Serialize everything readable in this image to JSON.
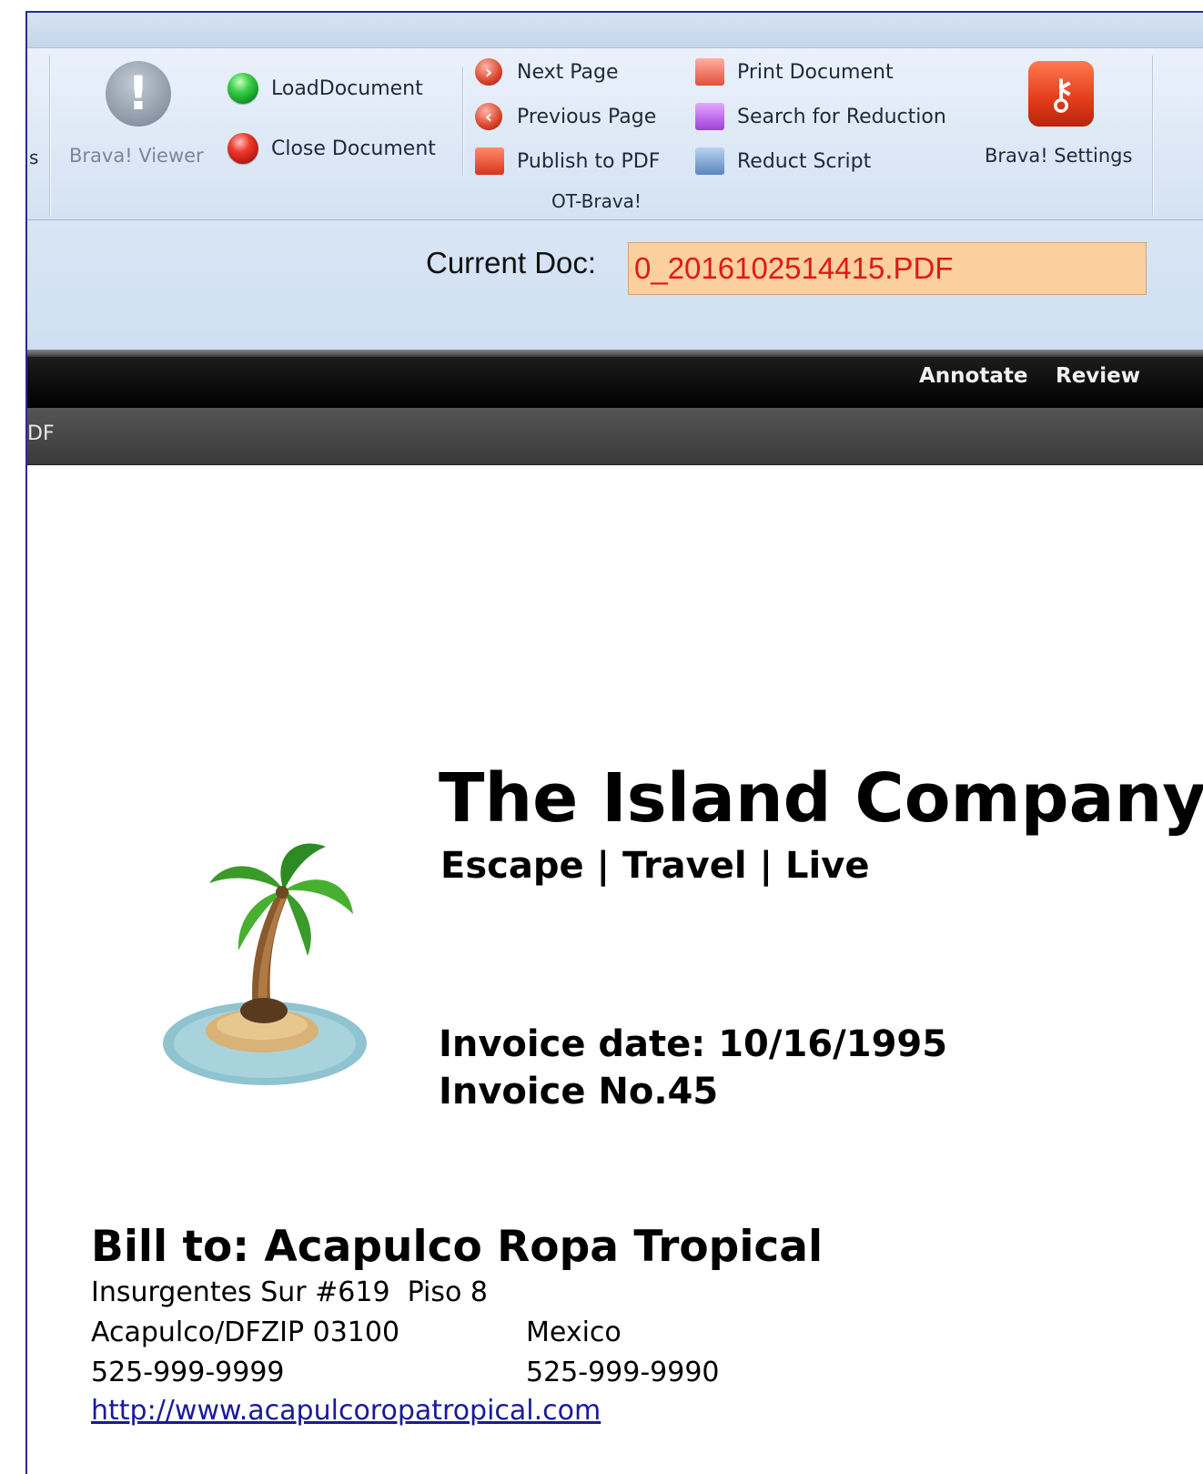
{
  "ribbon": {
    "left_edge_text": "s",
    "viewer_label": "Brava! Viewer",
    "load_document": "LoadDocument",
    "close_document": "Close Document",
    "next_page": "Next Page",
    "previous_page": "Previous Page",
    "publish_to_pdf": "Publish to PDF",
    "print_document": "Print Document",
    "search_for_reduction": "Search for Reduction",
    "reduct_script": "Reduct Script",
    "settings_label": "Brava! Settings",
    "group_label": "OT-Brava!"
  },
  "docbar": {
    "label": "Current Doc:",
    "value": "0_2016102514415.PDF"
  },
  "viewer_toolbar": {
    "menu": [
      "Annotate",
      "Review"
    ],
    "tab_tail": "DF"
  },
  "document": {
    "company": "The Island Company",
    "tagline": "Escape | Travel | Live",
    "invoice_date": "Invoice date: 10/16/1995",
    "invoice_no": "Invoice No.45",
    "bill_to": "Bill to: Acapulco Ropa Tropical",
    "address_line1": "Insurgentes Sur #619  Piso 8",
    "address_line2_left": "Acapulco/DFZIP 03100",
    "address_line2_right": "Mexico",
    "phone": "525-999-9999",
    "fax": "525-999-9990",
    "website": "http://www.acapulcoropatropical.com"
  },
  "colors": {
    "ribbon_bg": "#dde8f6",
    "docbar_input_bg": "#fbcf9e",
    "docbar_input_text": "#e01a12",
    "toolbar_dark": "#000000",
    "link": "#1a1a9a"
  },
  "icons": {
    "viewer": "exclamation-icon",
    "load": "green-ball-icon",
    "close": "red-ball-icon",
    "next": "arrow-right-icon",
    "previous": "arrow-left-icon",
    "publish": "pdf-icon",
    "print": "print-icon",
    "search": "search-reduction-icon",
    "script": "script-icon",
    "settings": "key-icon",
    "logo": "palm-tree-island-logo"
  }
}
